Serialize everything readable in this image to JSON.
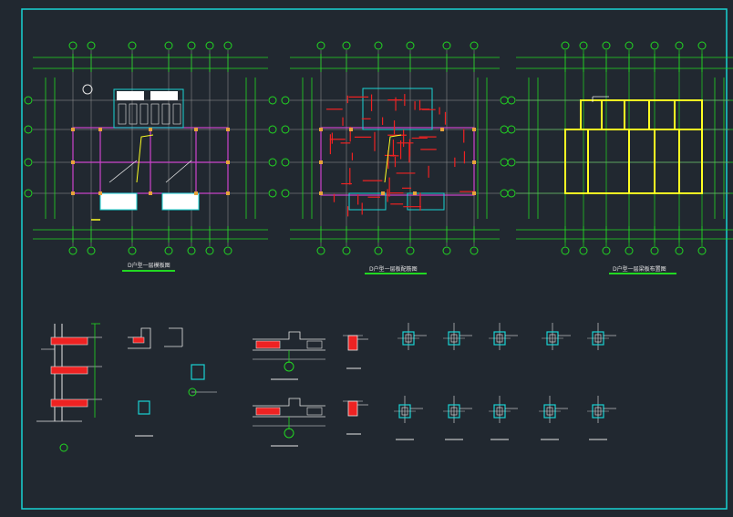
{
  "drawing": {
    "frame_color": "#19d3d3",
    "background": "#212830",
    "plans": [
      {
        "caption": "D户型一层模板图"
      },
      {
        "caption": "D户型一层板配筋图"
      },
      {
        "caption": "D户型一层梁板布置图"
      }
    ]
  },
  "colors": {
    "axis": "#22d822",
    "grid": "#9a9a9a",
    "beam": "#cc44cc",
    "rebar": "#ee2222",
    "slab": "#ffff22",
    "column": "#19d3d3",
    "text": "#e6e6e6"
  }
}
